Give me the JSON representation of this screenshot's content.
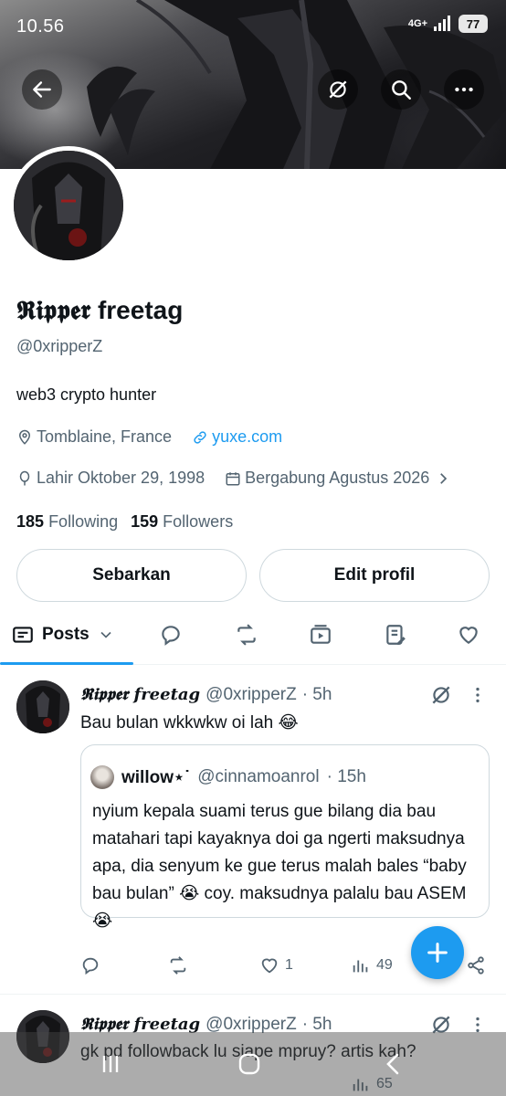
{
  "status_bar": {
    "time": "10.56",
    "network": "4G+",
    "battery": "77"
  },
  "header": {
    "back_icon": "back-arrow-icon",
    "grok_icon": "grok-icon",
    "search_icon": "search-icon",
    "more_icon": "more-dots-icon"
  },
  "profile": {
    "display_name": "𝕽𝖎𝖕𝖕𝖊𝖗 freetag",
    "handle": "@0xripperZ",
    "bio": "web3 crypto hunter",
    "location": "Tomblaine, France",
    "website": "yuxe.com",
    "birthday": "Lahir Oktober 29, 1998",
    "joined": "Bergabung Agustus 2026",
    "following_count": "185",
    "following_label": "Following",
    "followers_count": "159",
    "followers_label": "Followers",
    "share_button": "Sebarkan",
    "edit_button": "Edit profil"
  },
  "tabs": {
    "active_label": "Posts",
    "icons": [
      "reply-icon",
      "retweet-icon",
      "media-icon",
      "article-icon",
      "like-icon"
    ]
  },
  "posts": [
    {
      "author": "𝕽𝖎𝖕𝖕𝖊𝖗 freetag",
      "handle": "@0xripperZ",
      "time": "· 5h",
      "text": "Bau bulan wkkwkw oi lah 😂",
      "quote": {
        "author": "willow⋆˙",
        "handle": "@cinnamoanrol",
        "time": "· 15h",
        "text": "nyium kepala suami terus gue bilang dia bau matahari tapi kayaknya doi ga ngerti maksudnya apa, dia senyum ke gue terus malah bales “baby bau bulan” 😭 coy. maksudnya palalu bau ASEM 😭"
      },
      "likes": "1",
      "views": "49"
    },
    {
      "author": "𝕽𝖎𝖕𝖕𝖊𝖗 freetag",
      "handle": "@0xripperZ",
      "time": "· 5h",
      "text": "gk pd followback lu siape mpruy? artis kah?",
      "views": "65"
    }
  ],
  "fab_icon": "compose-plus-icon",
  "colors": {
    "accent": "#1d9bf0",
    "text": "#0f1419",
    "muted": "#536471",
    "border": "#cfd9de"
  }
}
